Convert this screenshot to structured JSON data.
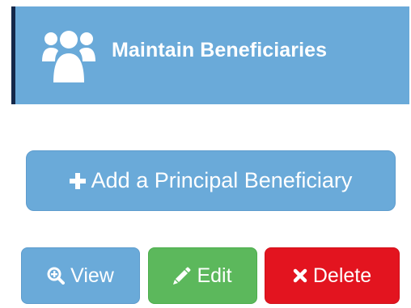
{
  "header": {
    "title": "Maintain Beneficiaries",
    "icon": "users-group-icon"
  },
  "actions": {
    "add_label": "Add a Principal Beneficiary",
    "add_icon": "plus-icon",
    "view_label": "View",
    "view_icon": "zoom-in-icon",
    "edit_label": "Edit",
    "edit_icon": "pencil-icon",
    "delete_label": "Delete",
    "delete_icon": "times-icon"
  },
  "colors": {
    "header_bg": "#6aaad9",
    "header_accent": "#14284a",
    "primary": "#6aaad9",
    "success": "#5cb85c",
    "danger": "#e3141f",
    "text": "#ffffff"
  }
}
